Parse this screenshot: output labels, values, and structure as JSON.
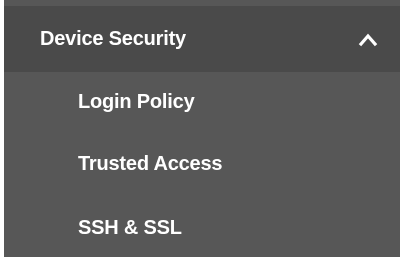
{
  "sidebar": {
    "section": {
      "label": "Device Security",
      "expanded": true,
      "icon": "chevron-up-icon"
    },
    "items": [
      {
        "label": "Login Policy"
      },
      {
        "label": "Trusted Access"
      },
      {
        "label": "SSH & SSL"
      }
    ]
  },
  "colors": {
    "panel_background": "#575757",
    "header_background": "#4a4a4a",
    "text": "#ffffff"
  }
}
